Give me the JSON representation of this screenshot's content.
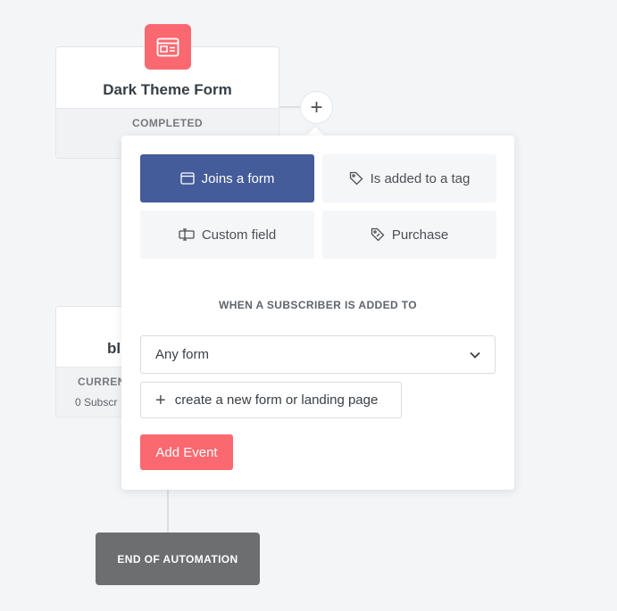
{
  "canvas": {
    "node_form": {
      "title": "Dark Theme Form",
      "status": "COMPLETED",
      "badge_icon": "form-window-icon",
      "badge_color": "#fb6970"
    },
    "add_step_symbol": "+",
    "node_second": {
      "title": "bl",
      "status": "CURREN",
      "subscribers": "0 Subscr"
    },
    "end_node": {
      "label": "END OF AUTOMATION",
      "color": "#6c6e70"
    }
  },
  "popup": {
    "options": [
      {
        "label": "Joins a form",
        "icon": "form-window-icon",
        "selected": true
      },
      {
        "label": "Is added to a tag",
        "icon": "tag-icon",
        "selected": false
      },
      {
        "label": "Custom field",
        "icon": "custom-field-icon",
        "selected": false
      },
      {
        "label": "Purchase",
        "icon": "price-tag-icon",
        "selected": false
      }
    ],
    "section_label": "WHEN A SUBSCRIBER IS ADDED TO",
    "select_value": "Any form",
    "create_label": "create a new form or landing page",
    "create_symbol": "+",
    "add_event_label": "Add Event",
    "accent_color": "#445c99",
    "cta_color": "#fb6970"
  }
}
